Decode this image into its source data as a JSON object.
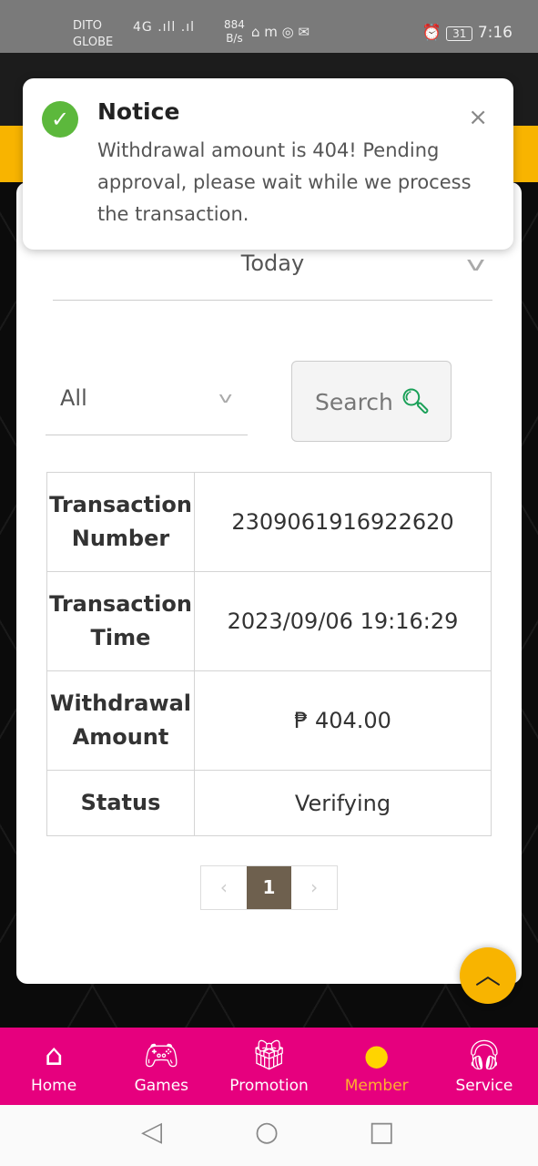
{
  "status_bar": {
    "carrier1": "DITO",
    "carrier2": "GLOBE",
    "signal": "4G .ıll .ıl",
    "speed_value": "884",
    "speed_unit": "B/s",
    "apps": "⌂ m ◎ ✉",
    "battery": "31",
    "time": "7:16"
  },
  "notice": {
    "title": "Notice",
    "message": "Withdrawal amount is 404! Pending approval, please wait while we process the transaction.",
    "close": "×"
  },
  "filters": {
    "date": "Today",
    "type": "All",
    "search_label": "Search"
  },
  "table": {
    "rows": [
      {
        "label": "Transaction Number",
        "value": "2309061916922620"
      },
      {
        "label": "Transaction Time",
        "value": "2023/09/06 19:16:29"
      },
      {
        "label": "Withdrawal Amount",
        "value": "₱ 404.00"
      },
      {
        "label": "Status",
        "value": "Verifying"
      }
    ]
  },
  "pagination": {
    "prev": "‹",
    "current": "1",
    "next": "›"
  },
  "bottom_nav": [
    {
      "label": "Home",
      "icon": "home-icon"
    },
    {
      "label": "Games",
      "icon": "gamepad-icon"
    },
    {
      "label": "Promotion",
      "icon": "gift-icon"
    },
    {
      "label": "Member",
      "icon": "member-icon",
      "active": true
    },
    {
      "label": "Service",
      "icon": "headset-icon"
    }
  ],
  "colors": {
    "brand_pink": "#e6007e",
    "accent_yellow": "#f8b400",
    "success_green": "#5cb83c"
  }
}
